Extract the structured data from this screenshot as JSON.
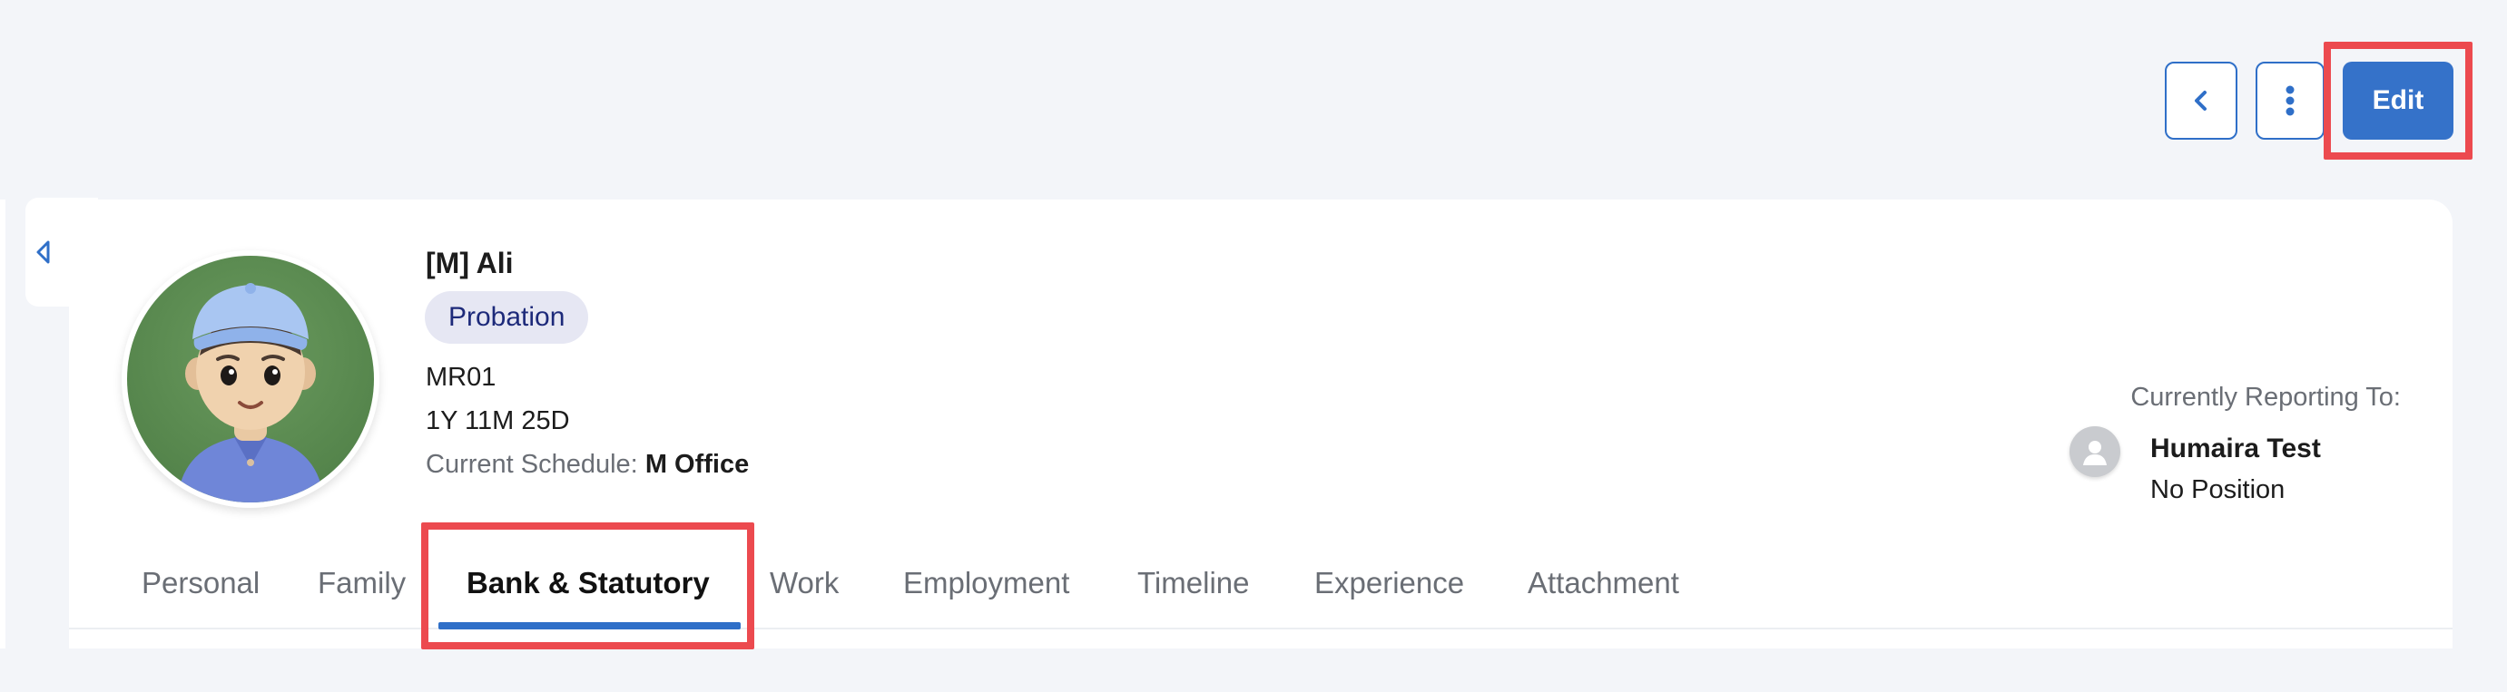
{
  "actions": {
    "edit_label": "Edit",
    "back_icon": "chevron-left-icon",
    "more_icon": "more-vertical-icon"
  },
  "employee": {
    "name": "[M] Ali",
    "status": "Probation",
    "code": "MR01",
    "tenure": "1Y 11M 25D",
    "schedule_label": "Current Schedule:",
    "schedule_value": "M Office",
    "avatar_icon": "avatar-illustration"
  },
  "reporting": {
    "label": "Currently Reporting To:",
    "manager_name": "Humaira Test",
    "manager_position": "No Position",
    "manager_icon": "person-icon"
  },
  "tabs": [
    {
      "label": "Personal"
    },
    {
      "label": "Family"
    },
    {
      "label": "Bank & Statutory"
    },
    {
      "label": "Work"
    },
    {
      "label": "Employment"
    },
    {
      "label": "Timeline"
    },
    {
      "label": "Experience"
    },
    {
      "label": "Attachment"
    }
  ],
  "active_tab": "Bank & Statutory",
  "colors": {
    "accent": "#3572c9",
    "highlight": "#ec4a4f",
    "badge_bg": "#e6e7f3",
    "badge_text": "#1d2a7a"
  }
}
